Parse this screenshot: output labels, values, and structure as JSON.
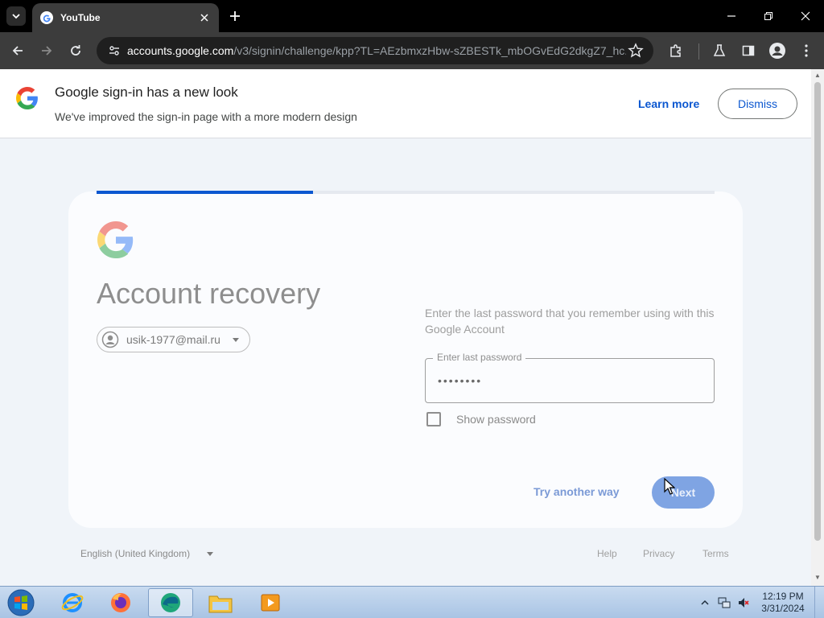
{
  "browser": {
    "tab_title": "YouTube",
    "url_host": "accounts.google.com",
    "url_path": "/v3/signin/challenge/kpp?TL=AEzbmxzHbw-sZBESTk_mbOGvEdG2dkgZ7_hc..."
  },
  "banner": {
    "title": "Google sign-in has a new look",
    "subtitle": "We've improved the sign-in page with a more modern design",
    "learn_more": "Learn more",
    "dismiss": "Dismiss"
  },
  "signin": {
    "progress": 0.35,
    "heading": "Account recovery",
    "account_email": "usik-1977@mail.ru",
    "description": "Enter the last password that you remember using with this Google Account",
    "password_label": "Enter last password",
    "password_value": "••••••••",
    "show_password_label": "Show password",
    "show_password_checked": false,
    "try_another_way": "Try another way",
    "next": "Next"
  },
  "footer": {
    "language": "English (United Kingdom)",
    "help": "Help",
    "privacy": "Privacy",
    "terms": "Terms"
  },
  "taskbar": {
    "time": "12:19 PM",
    "date": "3/31/2024"
  },
  "colors": {
    "accent": "#0b57d0",
    "next_disabled": "#7fa4e3",
    "page_bg": "#f0f4f9"
  }
}
